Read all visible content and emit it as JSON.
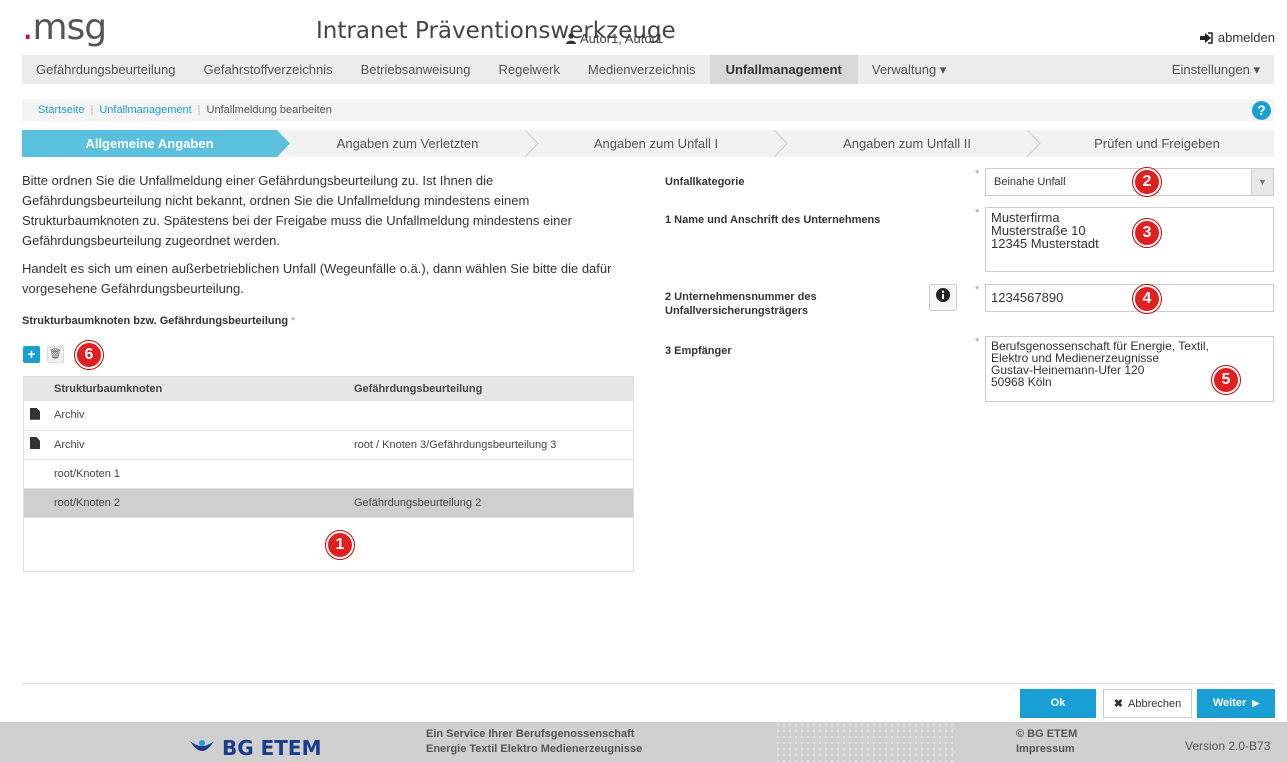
{
  "header": {
    "logo_mark": ".",
    "logo_text": "msg",
    "title": "Intranet Präventionswerkzeuge",
    "user": "Autor1, Autor1",
    "logout": "abmelden"
  },
  "nav": {
    "items": [
      "Gefährdungsbeurteilung",
      "Gefahrstoffverzeichnis",
      "Betriebsanweisung",
      "Regelwerk",
      "Medienverzeichnis",
      "Unfallmanagement",
      "Verwaltung ▾"
    ],
    "active": "Unfallmanagement",
    "settings": "Einstellungen ▾"
  },
  "breadcrumb": {
    "home": "Startseite",
    "section": "Unfallmanagement",
    "current": "Unfallmeldung bearbeiten"
  },
  "help": "?",
  "wizard": {
    "steps": [
      "Allgemeine Angaben",
      "Angaben zum Verletzten",
      "Angaben zum Unfall I",
      "Angaben zum Unfall II",
      "Prüfen und Freigeben"
    ],
    "active": 0,
    "active_color": "#5bc0de"
  },
  "intro": {
    "p1": "Bitte ordnen Sie die Unfallmeldung einer Gefährdungsbeurteilung zu. Ist Ihnen die Gefährdungsbeurteilung nicht bekannt, ordnen Sie die Unfallmeldung mindestens einem Strukturbaumknoten zu. Spätestens bei der Freigabe muss die Unfallmeldung mindestens einer Gefährdungsbeurteilung zugeordnet werden.",
    "p2": "Handelt es sich um einen außerbetrieblichen Unfall (Wegeunfälle o.ä.), dann wählen Sie bitte die dafür vorgesehene Gefährdungsbeurteilung."
  },
  "tree": {
    "label": "Strukturbaumknoten bzw. Gefährdungsbeurteilung",
    "required": "*",
    "add": "+",
    "delete": "🗑",
    "columns": [
      "Strukturbaumknoten",
      "Gefährdungsbeurteilung"
    ],
    "rows": [
      {
        "icon": "file-icon",
        "node": "Archiv",
        "assessment": ""
      },
      {
        "icon": "file-icon",
        "node": "Archiv",
        "assessment": "root / Knoten 3/Gefährdungsbeurteilung 3"
      },
      {
        "icon": "",
        "node": "root/Knoten 1",
        "assessment": ""
      },
      {
        "icon": "",
        "node": "root/Knoten 2",
        "assessment": "Gefährdungsbeurteilung 2",
        "selected": true
      }
    ]
  },
  "badges": [
    "1",
    "2",
    "3",
    "4",
    "5",
    "6"
  ],
  "form": {
    "category_label": "Unfallkategorie",
    "category_value": "Beinahe Unfall",
    "company_label": "1 Name und Anschrift des Unternehmens",
    "company_lines": [
      "Musterfirma",
      "Musterstraße 10",
      "12345 Musterstadt"
    ],
    "number_label": "2 Unternehmensnummer des Unfallversicherungsträgers",
    "number_value": "1234567890",
    "recipient_label": "3 Empfänger",
    "recipient_lines": [
      "Berufsgenossenschaft für Energie, Textil,",
      "Elektro und Medienerzeugnisse",
      "Gustav-Heinemann-Ufer 120",
      "50968 Köln"
    ],
    "required": "*"
  },
  "buttons": {
    "ok": "Ok",
    "cancel": "Abbrechen",
    "next": "Weiter"
  },
  "footer": {
    "logo": "BG ETEM",
    "service_1": "Ein Service Ihrer Berufsgenossenschaft",
    "service_2": "Energie Textil Elektro Medienerzeugnisse",
    "copyright": "© BG ETEM",
    "imprint": "Impressum",
    "version": "Version 2.0-B73"
  }
}
